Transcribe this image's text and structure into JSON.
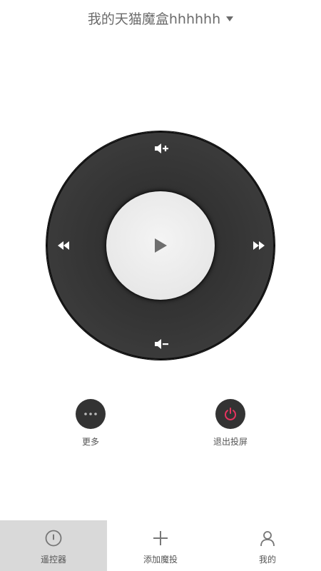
{
  "header": {
    "device_name": "我的天猫魔盒hhhhhh",
    "dropdown_icon": "caret-down-icon"
  },
  "remote": {
    "up_icon": "volume-up-icon",
    "down_icon": "volume-down-icon",
    "left_icon": "rewind-icon",
    "right_icon": "fast-forward-icon",
    "center_icon": "play-icon"
  },
  "actions": {
    "more_label": "更多",
    "more_icon": "more-dots-icon",
    "exit_label": "退出投屏",
    "exit_icon": "power-icon",
    "exit_icon_color": "#e8335f"
  },
  "tabs": [
    {
      "label": "遥控器",
      "icon": "remote-icon",
      "active": true
    },
    {
      "label": "添加魔投",
      "icon": "plus-icon",
      "active": false
    },
    {
      "label": "我的",
      "icon": "user-icon",
      "active": false
    }
  ],
  "colors": {
    "dial": "#3a3a3a",
    "center": "#e8e8e8",
    "active_tab_bg": "#d9d9d9",
    "accent": "#e8335f"
  }
}
